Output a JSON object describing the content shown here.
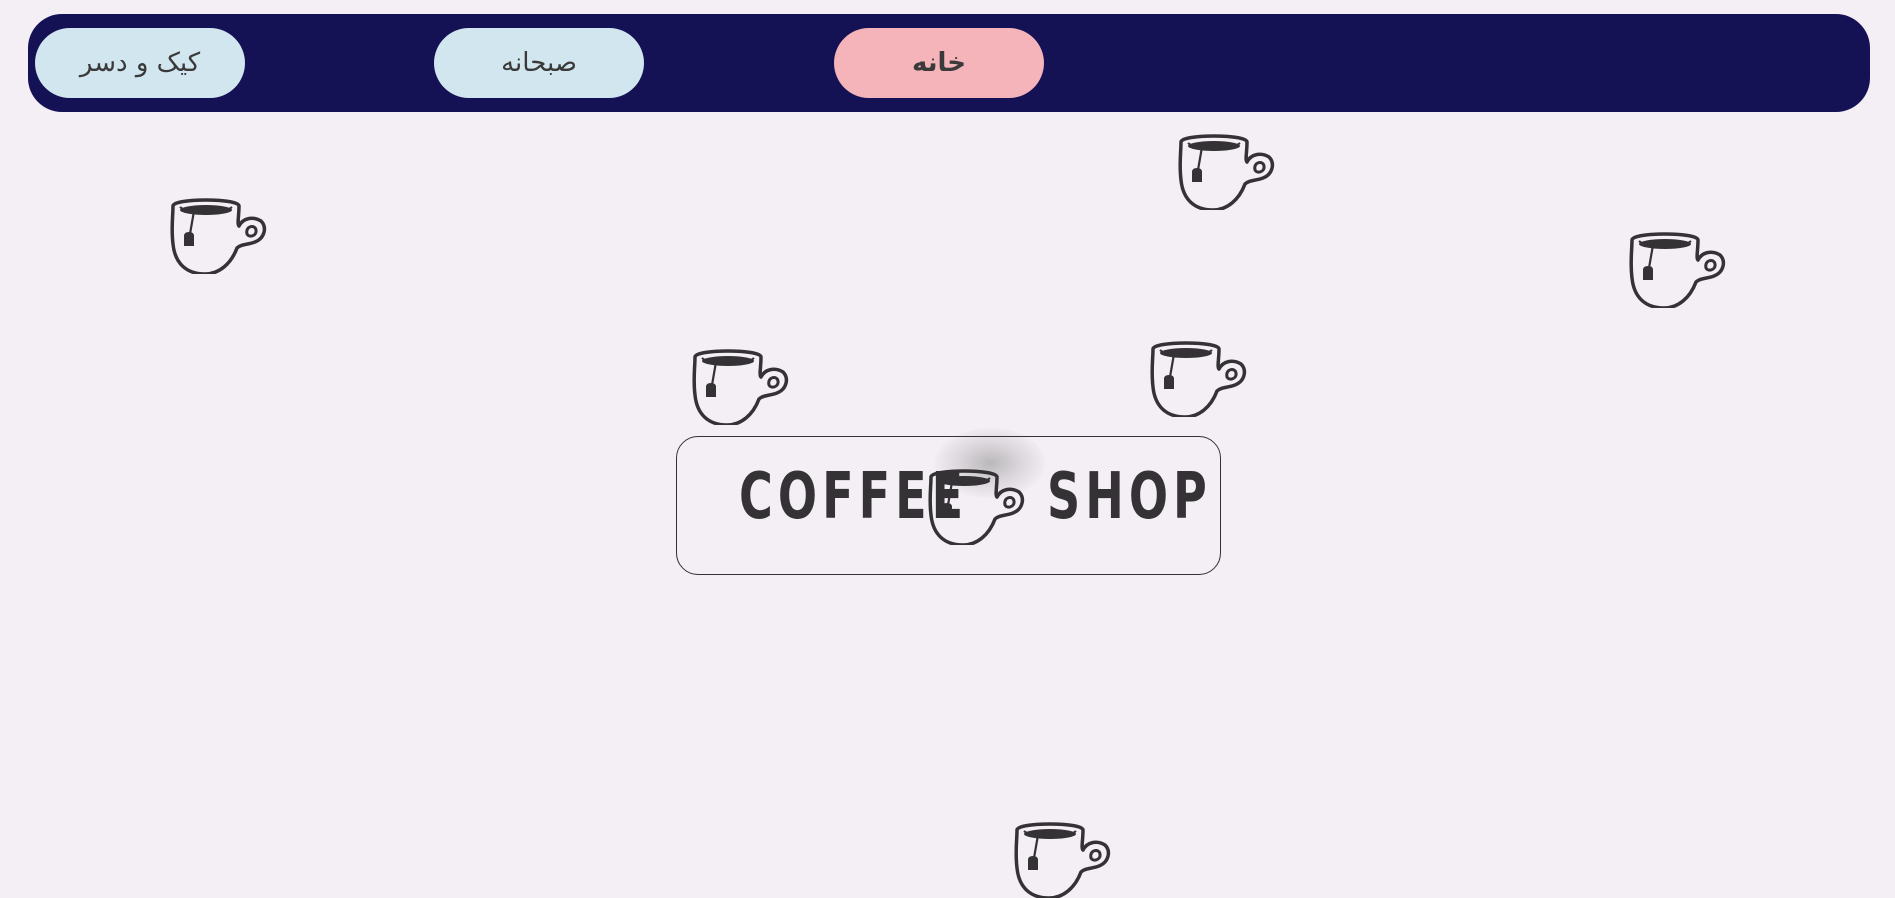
{
  "nav": {
    "items": [
      {
        "label": "کیک و دسر",
        "active": false
      },
      {
        "label": "صبحانه",
        "active": false
      },
      {
        "label": "خانه",
        "active": true
      }
    ]
  },
  "logo": {
    "word_left": "COFFEE",
    "word_right": "SHOP",
    "icon": "tea-cup-icon"
  },
  "decor": {
    "icon": "tea-cup-icon",
    "count": 8
  },
  "colors": {
    "background": "#f4eef5",
    "navbar": "#141155",
    "button": "#d2e6ef",
    "button_active": "#f4b4ba",
    "ink": "#353236"
  }
}
